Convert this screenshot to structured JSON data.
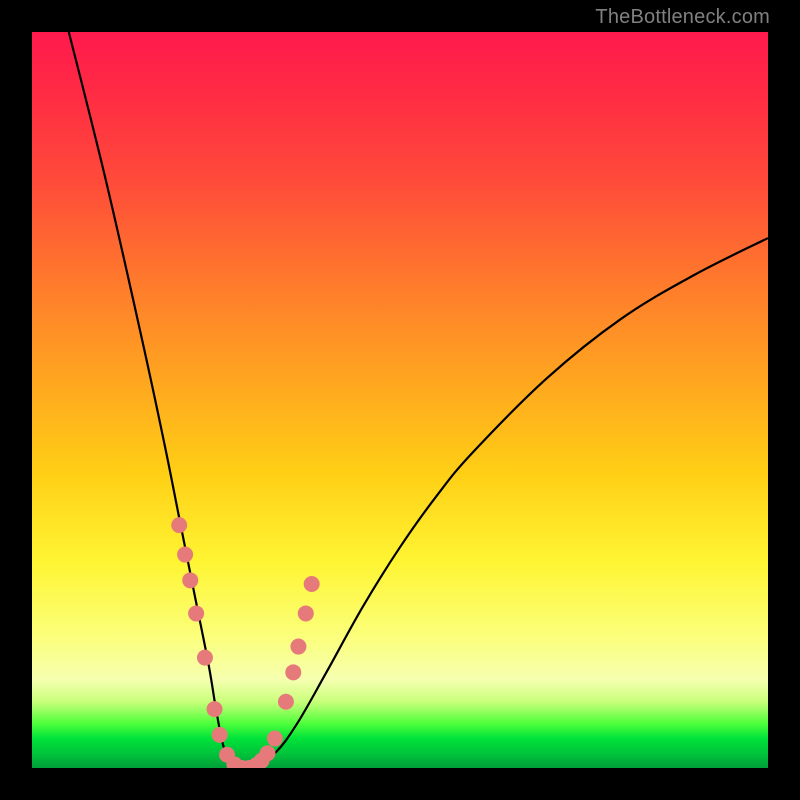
{
  "watermark": "TheBottleneck.com",
  "chart_data": {
    "type": "line",
    "title": "",
    "xlabel": "",
    "ylabel": "",
    "xlim": [
      0,
      100
    ],
    "ylim": [
      0,
      100
    ],
    "series": [
      {
        "name": "curve",
        "x": [
          5,
          10,
          15,
          18,
          20,
          22,
          24,
          25,
          26,
          27,
          28,
          30,
          33,
          36,
          40,
          45,
          50,
          55,
          60,
          70,
          80,
          90,
          100
        ],
        "values": [
          100,
          80,
          58,
          44,
          34,
          24,
          14,
          8,
          3,
          1,
          0,
          0,
          2,
          6,
          13,
          22,
          30,
          37,
          43,
          53,
          61,
          67,
          72
        ]
      }
    ],
    "markers": {
      "name": "dots",
      "color": "#e67a7a",
      "radius_px": 8,
      "x": [
        20.0,
        20.8,
        21.5,
        22.3,
        23.5,
        24.8,
        25.5,
        26.5,
        27.5,
        28.5,
        29.5,
        30.5,
        31.2,
        32.0,
        33.0,
        34.5,
        35.5,
        36.2,
        37.2,
        38.0
      ],
      "values": [
        33.0,
        29.0,
        25.5,
        21.0,
        15.0,
        8.0,
        4.5,
        1.8,
        0.5,
        0.0,
        0.0,
        0.4,
        1.0,
        2.0,
        4.0,
        9.0,
        13.0,
        16.5,
        21.0,
        25.0
      ]
    }
  }
}
